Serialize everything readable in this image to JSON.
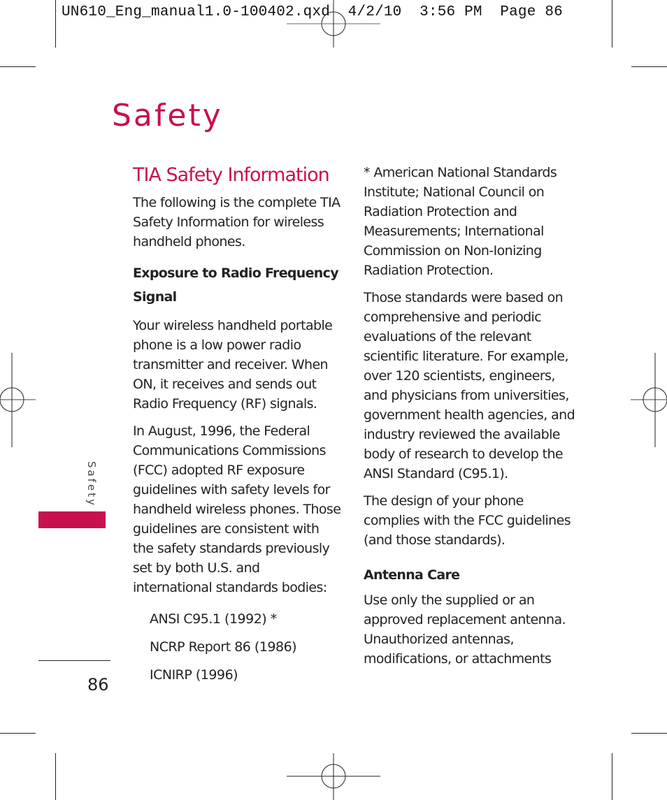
{
  "print_slug": {
    "filename": "UN610_Eng_manual1.0-100402.qxd",
    "date": "4/2/10",
    "time": "3:56 PM",
    "page_label": "Page 86"
  },
  "page": {
    "title": "Safety",
    "side_tab_label": "Safety",
    "page_number": "86",
    "accent_color": "#c8104f"
  },
  "left_column": {
    "section_title": "TIA Safety Information",
    "intro": "The following is the complete TIA Safety Information for wireless handheld phones.",
    "subheading": "Exposure to Radio Frequency Signal",
    "paragraphs": [
      "Your wireless handheld portable phone is a low power radio transmitter and receiver. When ON, it receives and sends out Radio Frequency (RF) signals.",
      "In August, 1996, the Federal Communications Commissions (FCC) adopted RF exposure guidelines with safety levels for handheld wireless phones. Those guidelines are consistent with the safety standards previously set by both U.S. and international standards bodies:"
    ],
    "standards": [
      "ANSI C95.1 (1992) *",
      "NCRP Report 86 (1986)",
      "ICNIRP (1996)"
    ]
  },
  "right_column": {
    "footnote": "* American National Standards Institute; National Council on Radiation Protection and Measurements; International Commission on Non-Ionizing Radiation Protection.",
    "paragraphs": [
      "Those standards were based on comprehensive and periodic evaluations of the relevant scientific literature. For example, over 120 scientists, engineers, and physicians from universities, government health agencies, and industry reviewed the available body of research to develop the ANSI Standard (C95.1).",
      "The design of your phone complies with the FCC guidelines (and those standards)."
    ],
    "subheading": "Antenna Care",
    "antenna_text": "Use only the supplied or an approved replacement antenna. Unauthorized antennas, modifications, or attachments"
  }
}
